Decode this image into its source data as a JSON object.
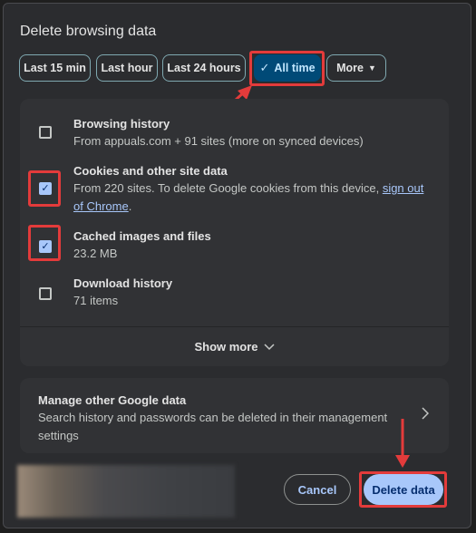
{
  "dialog": {
    "title": "Delete browsing data"
  },
  "time_range": {
    "options": [
      {
        "label": "Last 15 min"
      },
      {
        "label": "Last hour"
      },
      {
        "label": "Last 24 hours"
      },
      {
        "label": "All time",
        "selected": true,
        "icon": "check-icon"
      },
      {
        "label": "More",
        "icon": "caret-down-icon"
      }
    ]
  },
  "data_types": [
    {
      "title": "Browsing history",
      "subtitle": "From appuals.com + 91 sites (more on synced devices)",
      "checked": false
    },
    {
      "title": "Cookies and other site data",
      "subtitle_prefix": "From 220 sites. To delete Google cookies from this device, ",
      "link_text": "sign out of Chrome",
      "subtitle_suffix": ".",
      "checked": true
    },
    {
      "title": "Cached images and files",
      "subtitle": "23.2 MB",
      "checked": true
    },
    {
      "title": "Download history",
      "subtitle": "71 items",
      "checked": false
    }
  ],
  "show_more": {
    "label": "Show more",
    "icon": "chevron-down-icon"
  },
  "manage": {
    "title": "Manage other Google data",
    "subtitle": "Search history and passwords can be deleted in their management settings",
    "icon": "chevron-right-icon"
  },
  "actions": {
    "cancel_label": "Cancel",
    "delete_label": "Delete data"
  },
  "colors": {
    "accent": "#a8c7fa",
    "annotation": "#e33b3b",
    "selected_chip": "#004a77"
  }
}
